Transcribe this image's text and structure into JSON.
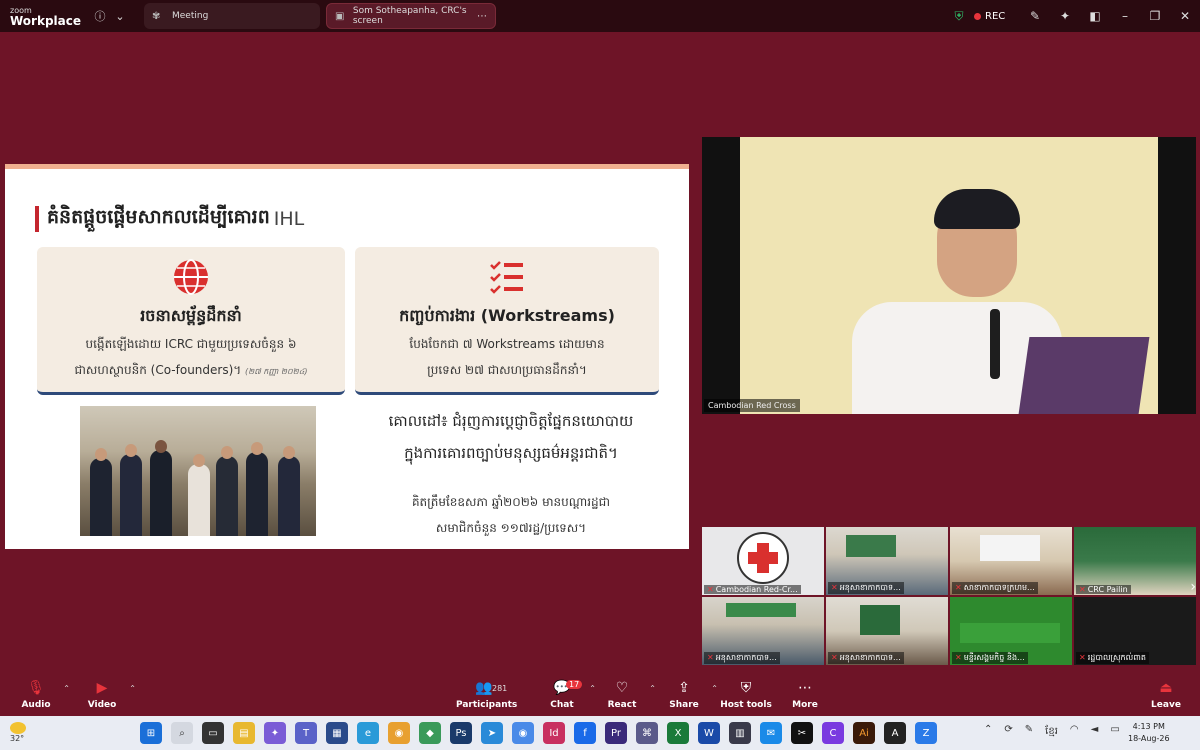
{
  "window": {
    "logo_top": "zoom",
    "logo_bottom": "Workplace",
    "tabs": [
      {
        "label": "Meeting",
        "icon": "paw-icon"
      },
      {
        "label": "Som Sotheapanha, CRC's screen",
        "icon": "screen-share-icon"
      }
    ],
    "rec_label": "REC"
  },
  "slide": {
    "title": "គំនិតផ្តួចផ្តើមសាកលដើម្បីគោរព",
    "title_suffix": "IHL",
    "card1": {
      "heading": "រចនាសម្ព័ន្ធដឹកនាំ",
      "line1": "បង្កើតឡើងដោយ ICRC ជាមួយប្រទេសចំនួន ៦",
      "line2": "ជាសហស្ថាបនិក (Co-founders)។",
      "note": "(២៧ កញ្ញា ២០២៤)"
    },
    "card2": {
      "heading": "កញ្ចប់ការងារ (Workstreams)",
      "line1": "បែងចែកជា ៧ Workstreams ដោយមាន",
      "line2": "ប្រទេស ២៧ ជាសហប្រធានដឹកនាំ។"
    },
    "goal_line1": "គោលដៅ៖ ជំរុញការប្តេជ្ញាចិត្តផ្នែកនយោបាយ",
    "goal_line2": "ក្នុងការគោរពច្បាប់មនុស្សធម៌អន្តរជាតិ។",
    "membership_line1": "គិតត្រឹមខែឧសភា ឆ្នាំ២០២៦ មានបណ្តារដ្ឋជា",
    "membership_line2": "សមាជិកចំនួន ១១៧រដ្ឋ/ប្រទេស។"
  },
  "speaker": {
    "name": "Cambodian Red Cross"
  },
  "gallery": [
    {
      "name": "Cambodian Red-Cr..."
    },
    {
      "name": "អនុសាខាកាកបាទ..."
    },
    {
      "name": "សាខាកាកបាទក្រហម..."
    },
    {
      "name": "CRC Pailin"
    },
    {
      "name": "អនុសាខាកាកបាទ..."
    },
    {
      "name": "អនុសាខាកាកបាទ..."
    },
    {
      "name": "មន្ទីរសង្គមកិច្ច និង..."
    },
    {
      "name": "រដ្ឋបាលស្រុកល់ពាត"
    }
  ],
  "toolbar": {
    "audio": "Audio",
    "video": "Video",
    "participants": "Participants",
    "participants_count": "281",
    "chat": "Chat",
    "chat_badge": "17",
    "react": "React",
    "share": "Share",
    "host_tools": "Host tools",
    "more": "More",
    "leave": "Leave"
  },
  "taskbar": {
    "weather": "32°",
    "time": "4:13 PM",
    "date": "18-Aug-26",
    "lang": "ខ្មែរ"
  },
  "colors": {
    "background": "#6e1427",
    "topbar": "#2a0a10",
    "accent_red": "#c4262e",
    "card_border": "#2e4a7a",
    "rec_red": "#e8343c"
  }
}
